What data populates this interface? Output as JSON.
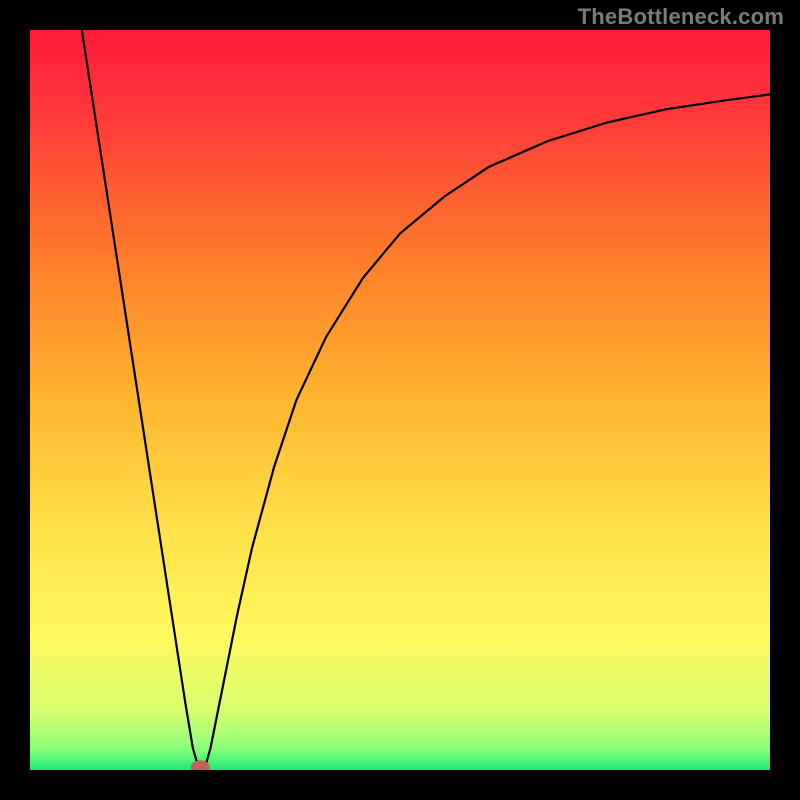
{
  "branding": {
    "watermark": "TheBottleneck.com"
  },
  "chart_data": {
    "type": "line",
    "title": "",
    "xlabel": "",
    "ylabel": "",
    "xlim": [
      0,
      100
    ],
    "ylim": [
      0,
      100
    ],
    "background_gradient": {
      "stops": [
        {
          "offset": 0.0,
          "color": "#ff1a3a"
        },
        {
          "offset": 0.12,
          "color": "#ff3a3a"
        },
        {
          "offset": 0.3,
          "color": "#ff7a2a"
        },
        {
          "offset": 0.5,
          "color": "#ffb52e"
        },
        {
          "offset": 0.68,
          "color": "#ffe24a"
        },
        {
          "offset": 0.82,
          "color": "#fff95e"
        },
        {
          "offset": 0.92,
          "color": "#d8ff6e"
        },
        {
          "offset": 0.97,
          "color": "#8dff7a"
        },
        {
          "offset": 1.0,
          "color": "#20e87a"
        }
      ]
    },
    "series": [
      {
        "name": "bottleneck-curve",
        "color": "#000000",
        "stroke_width": 2.2,
        "points": [
          {
            "x": 7.0,
            "y": 100.0
          },
          {
            "x": 9.0,
            "y": 87.0
          },
          {
            "x": 11.0,
            "y": 74.0
          },
          {
            "x": 13.0,
            "y": 61.0
          },
          {
            "x": 15.0,
            "y": 48.0
          },
          {
            "x": 17.0,
            "y": 35.0
          },
          {
            "x": 19.0,
            "y": 22.0
          },
          {
            "x": 21.0,
            "y": 9.0
          },
          {
            "x": 22.0,
            "y": 3.0
          },
          {
            "x": 22.8,
            "y": 0.2
          },
          {
            "x": 23.6,
            "y": 0.2
          },
          {
            "x": 24.4,
            "y": 3.0
          },
          {
            "x": 26.0,
            "y": 11.0
          },
          {
            "x": 28.0,
            "y": 21.0
          },
          {
            "x": 30.0,
            "y": 30.0
          },
          {
            "x": 33.0,
            "y": 41.0
          },
          {
            "x": 36.0,
            "y": 50.0
          },
          {
            "x": 40.0,
            "y": 58.5
          },
          {
            "x": 45.0,
            "y": 66.5
          },
          {
            "x": 50.0,
            "y": 72.5
          },
          {
            "x": 56.0,
            "y": 77.5
          },
          {
            "x": 62.0,
            "y": 81.5
          },
          {
            "x": 70.0,
            "y": 85.0
          },
          {
            "x": 78.0,
            "y": 87.5
          },
          {
            "x": 86.0,
            "y": 89.3
          },
          {
            "x": 94.0,
            "y": 90.5
          },
          {
            "x": 100.0,
            "y": 91.3
          }
        ]
      }
    ],
    "marker": {
      "x": 23.0,
      "y": 0.0,
      "rx": 1.3,
      "ry": 0.9,
      "color": "#c6605a"
    }
  }
}
